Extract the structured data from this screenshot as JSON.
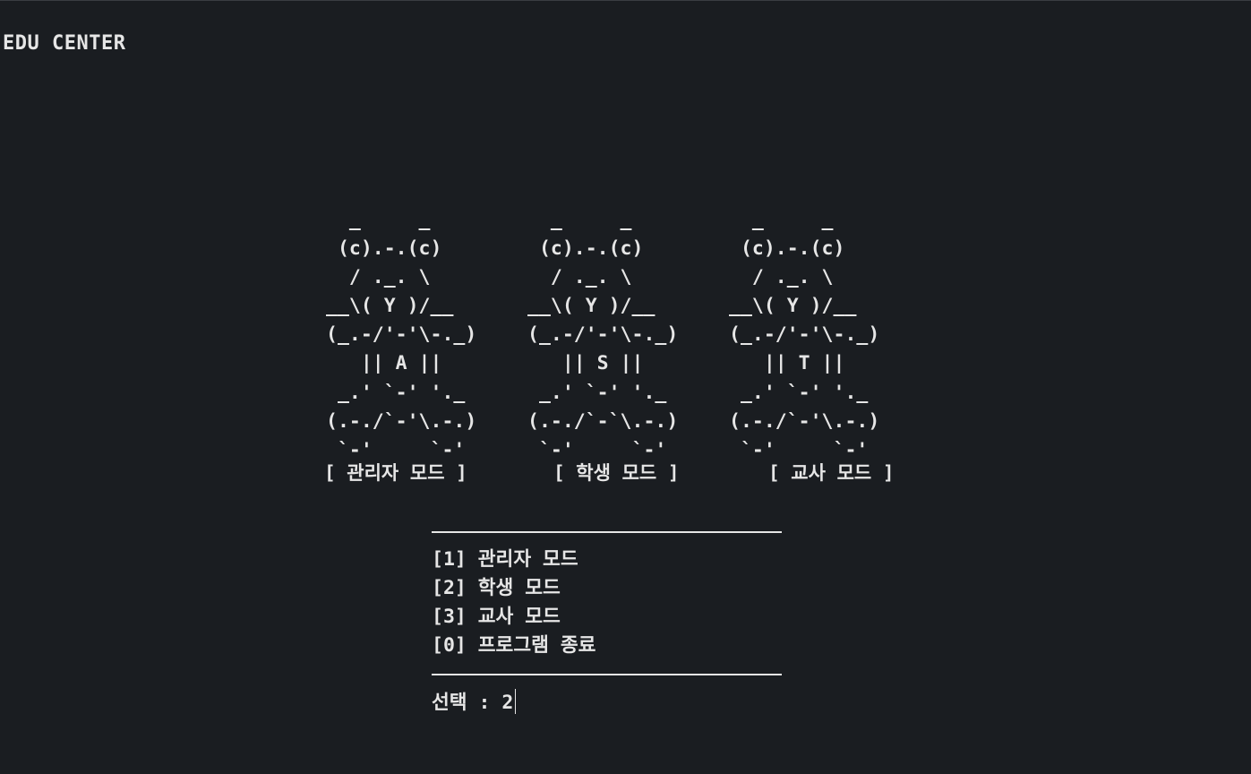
{
  "window": {
    "title": "EDU CENTER"
  },
  "bears": [
    {
      "art": "  _     _\n (c).-.(c)\n  / ._. \\\n__\\( Y )/__\n(_.-/'-'\\-._)\n   || A ||\n _.' `-' '._\n(.-./`-'\\.-.)\n `-'     `-'",
      "label": "[ 관리자 모드 ]"
    },
    {
      "art": "  _     _\n (c).-.(c)\n  / ._. \\\n__\\( Y )/__\n(_.-/'-'\\-._)\n   || S ||\n _.' `-' '._\n(.-./`-`\\.-.)\n `-'     `-'",
      "label": "[ 학생 모드 ]"
    },
    {
      "art": "  _     _\n (c).-.(c)\n  / ._. \\\n__\\( Y )/__\n(_.-/'-'\\-._)\n   || T ||\n _.' `-' '._\n(.-./`-'\\.-.)\n `-'     `-'",
      "label": "[ 교사 모드 ]"
    }
  ],
  "menu": {
    "items": [
      "[1] 관리자 모드",
      "[2] 학생 모드",
      "[3] 교사 모드",
      "[0] 프로그램 종료"
    ]
  },
  "prompt": {
    "label": "선택 :",
    "value": "2"
  }
}
